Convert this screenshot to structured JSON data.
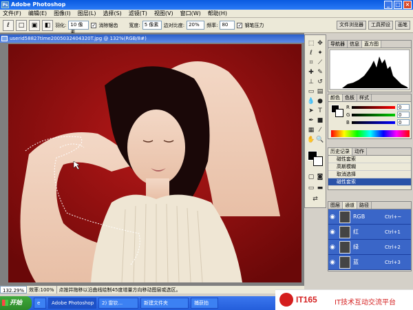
{
  "window": {
    "title": "Adobe Photoshop",
    "icon_label": "Ps"
  },
  "menu": [
    "文件(F)",
    "编辑(E)",
    "图像(I)",
    "图层(L)",
    "选择(S)",
    "滤镜(T)",
    "视图(V)",
    "窗口(W)",
    "帮助(H)"
  ],
  "options": {
    "feather_label": "羽化:",
    "feather_value": "10 像素",
    "antialias_label": "消除锯齿",
    "width_label": "宽度:",
    "width_value": "5 像素",
    "edge_contrast_label": "边对比度:",
    "edge_contrast_value": "20%",
    "frequency_label": "频率:",
    "frequency_value": "80",
    "pen_pressure_label": "钢笔压力",
    "well_buttons": [
      "文件浏览器",
      "工具预设",
      "画笔"
    ]
  },
  "document": {
    "title": "userid58827time2005032404320T.jpg @ 132%(RGB/8#)"
  },
  "status": {
    "zoom": "132.29%",
    "doc_info": "效率:100%",
    "hint": "点按并拖移以沿曲线绘制45度增量方向移动图层或选区。"
  },
  "panels": {
    "navigator_tabs": [
      "导航器",
      "信息",
      "直方图"
    ],
    "color_tabs": [
      "颜色",
      "色板",
      "样式"
    ],
    "color_rows": [
      {
        "label": "R",
        "value": "0"
      },
      {
        "label": "G",
        "value": "0"
      },
      {
        "label": "B",
        "value": "0"
      }
    ],
    "history_tabs": [
      "历史记录",
      "动作"
    ],
    "history_items": [
      "磁性套索",
      "高斯模糊",
      "取消选择",
      "磁性套索"
    ],
    "channels_tabs": [
      "图层",
      "通道",
      "路径"
    ],
    "channels": [
      {
        "name": "RGB",
        "key": "Ctrl+~"
      },
      {
        "name": "红",
        "key": "Ctrl+1"
      },
      {
        "name": "绿",
        "key": "Ctrl+2"
      },
      {
        "name": "蓝",
        "key": "Ctrl+3"
      }
    ]
  },
  "taskbar": {
    "start": "开始",
    "tasks": [
      "Adobe Photoshop",
      "2) 雷钦...",
      "新建文件夹",
      "捕获拍"
    ]
  },
  "logo": {
    "brand": "IT165",
    "tagline": "IT技术互动交流平台"
  },
  "colors": {
    "canvas_bg": "#9c1010",
    "title_blue": "#0a5ae0",
    "channel_selected": "#3a66c8",
    "logo_red": "#d41e1e"
  }
}
